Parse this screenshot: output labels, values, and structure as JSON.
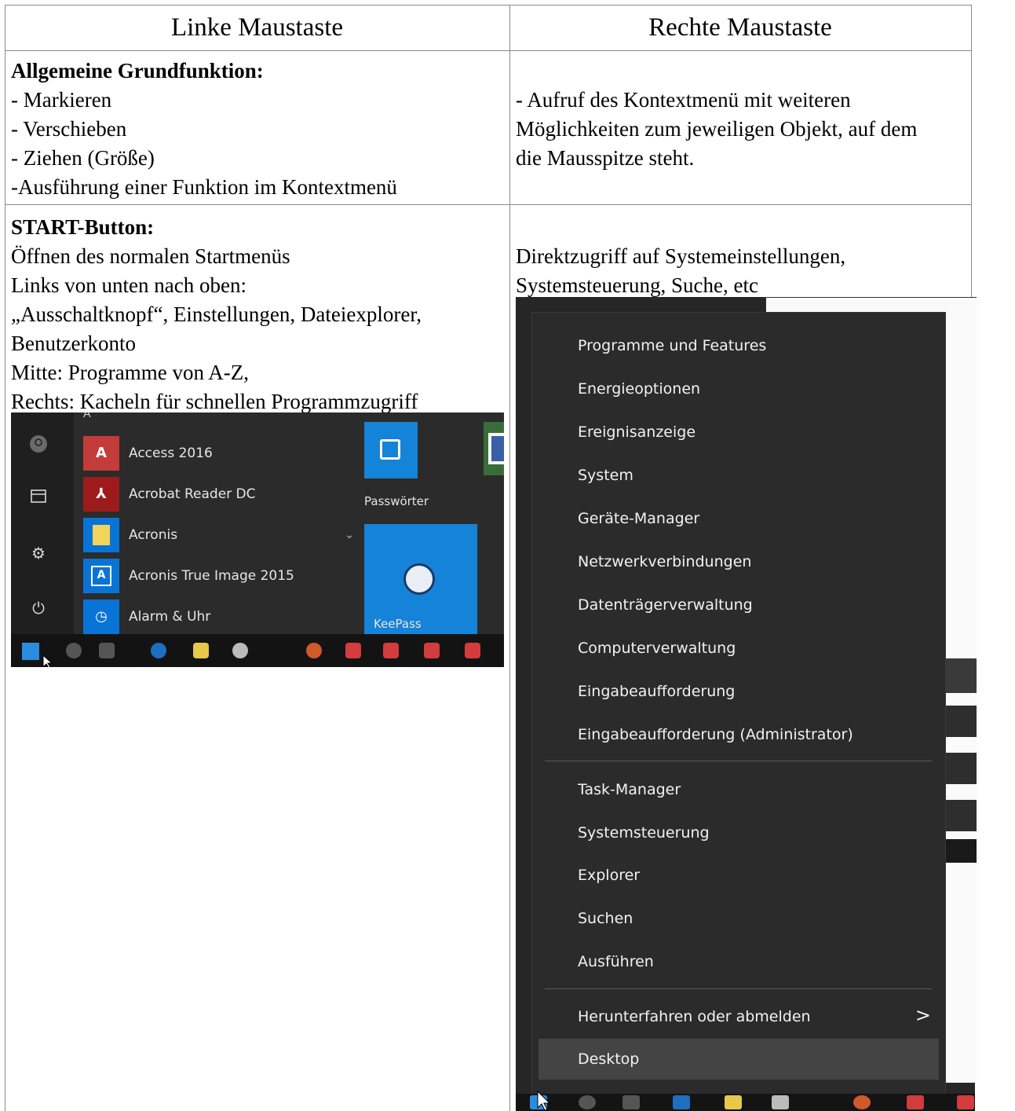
{
  "table": {
    "header_left": "Linke Maustaste",
    "header_right": "Rechte Maustaste",
    "row1": {
      "left_title": "Allgemeine Grundfunktion:",
      "left_lines": [
        "- Markieren",
        "- Verschieben",
        "- Ziehen (Größe)",
        "-Ausführung einer Funktion im Kontextmenü"
      ],
      "right_lines": [
        "- Aufruf des Kontextmenü mit weiteren",
        "Möglichkeiten zum jeweiligen Objekt, auf dem",
        "die Mausspitze steht."
      ]
    },
    "row2": {
      "left_title": "START-Button:",
      "left_lines": [
        "Öffnen des normalen Startmenüs",
        "Links von unten nach oben:",
        "„Ausschaltknopf“, Einstellungen, Dateiexplorer,",
        "Benutzerkonto",
        "Mitte: Programme von A-Z,",
        "Rechts: Kacheln für schnellen Programmzugriff"
      ],
      "right_lines": [
        "Direktzugriff auf Systemeinstellungen,",
        "Systemsteuerung, Suche, etc"
      ]
    }
  },
  "start_menu": {
    "section_letter": "A",
    "apps": [
      {
        "name": "Access 2016",
        "icon": "access-icon",
        "tile_color": "#c43b3b",
        "glyph": "A"
      },
      {
        "name": "Acrobat Reader DC",
        "icon": "acrobat-icon",
        "tile_color": "#b71d1d",
        "glyph": "⅄"
      },
      {
        "name": "Acronis",
        "icon": "folder-icon",
        "tile_color": "#f2d35c",
        "glyph": ""
      },
      {
        "name": "Acronis True Image 2015",
        "icon": "acronis-icon",
        "tile_color": "#0a74d6",
        "glyph": "A"
      },
      {
        "name": "Alarm & Uhr",
        "icon": "alarm-clock-icon",
        "tile_color": "#0a74d6",
        "glyph": "◷"
      }
    ],
    "tiles": [
      {
        "label": "Passwörter"
      },
      {
        "label": "KeePass"
      }
    ]
  },
  "context_menu": {
    "group1": [
      "Programme und Features",
      "Energieoptionen",
      "Ereignisanzeige",
      "System",
      "Geräte-Manager",
      "Netzwerkverbindungen",
      "Datenträgerverwaltung",
      "Computerverwaltung",
      "Eingabeaufforderung",
      "Eingabeaufforderung (Administrator)"
    ],
    "group2": [
      "Task-Manager",
      "Systemsteuerung",
      "Explorer",
      "Suchen",
      "Ausführen"
    ],
    "group3": [
      "Herunterfahren oder abmelden",
      "Desktop"
    ],
    "submenu_arrow": ">"
  },
  "colors": {
    "start_bg": "#2b2b2b",
    "tile_blue": "#1583d8",
    "menu_bg": "#2b2b2b",
    "menu_highlight": "#444444"
  }
}
